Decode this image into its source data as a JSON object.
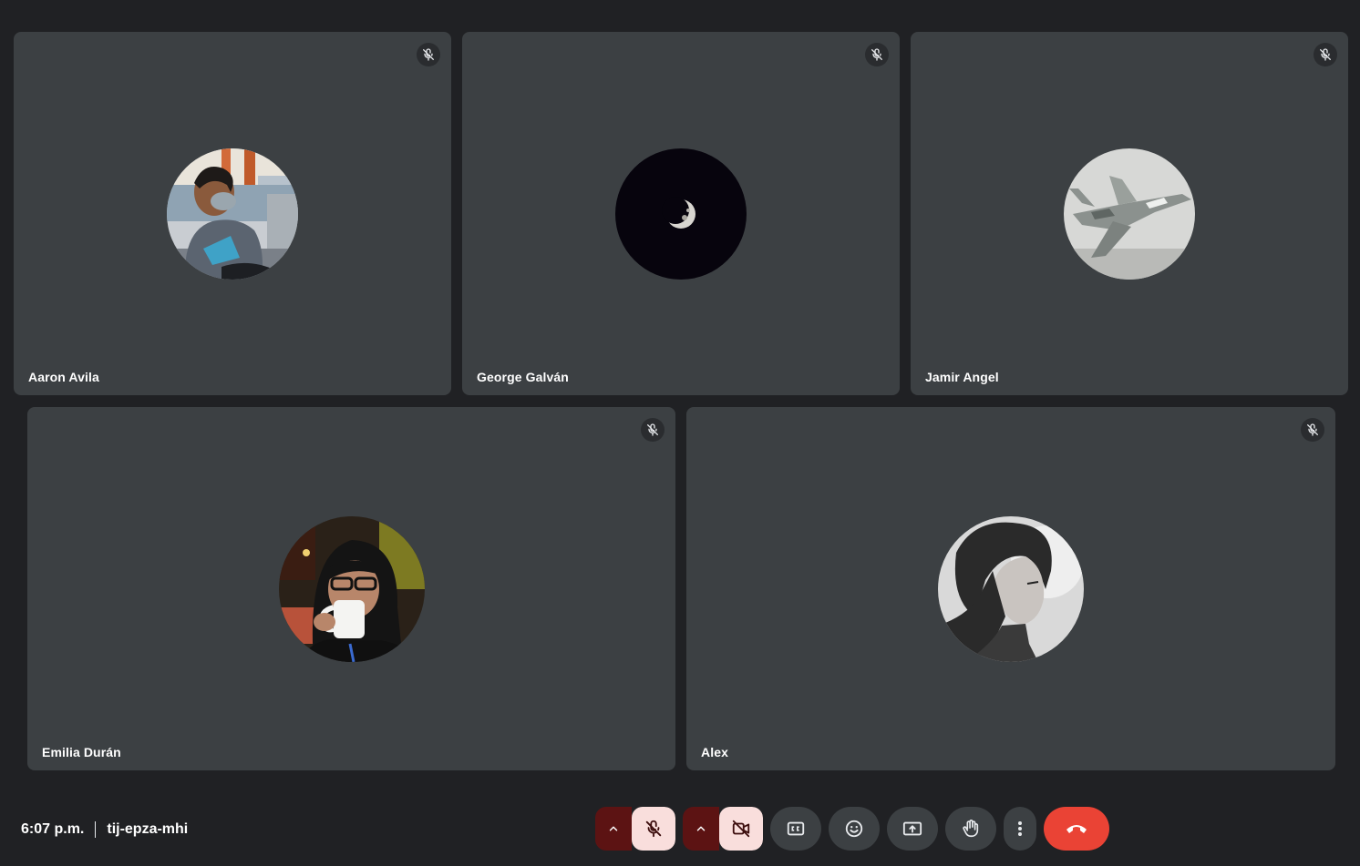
{
  "meeting": {
    "time": "6:07 p.m.",
    "code": "tij-epza-mhi"
  },
  "participants": [
    {
      "name": "Aaron Avila",
      "muted": true,
      "avatar": "photo-person-mask"
    },
    {
      "name": "George Galván",
      "muted": true,
      "avatar": "photo-moon"
    },
    {
      "name": "Jamir Angel",
      "muted": true,
      "avatar": "photo-jet"
    },
    {
      "name": "Emilia Durán",
      "muted": true,
      "avatar": "photo-person-mug"
    },
    {
      "name": "Alex",
      "muted": true,
      "avatar": "illustration-character"
    }
  ],
  "controls": [
    {
      "name": "audio-options",
      "icon": "chevron-up-icon"
    },
    {
      "name": "microphone",
      "icon": "mic-off-icon",
      "state": "off"
    },
    {
      "name": "video-options",
      "icon": "chevron-up-icon"
    },
    {
      "name": "camera",
      "icon": "videocam-off-icon",
      "state": "off"
    },
    {
      "name": "captions",
      "icon": "closed-captions-icon"
    },
    {
      "name": "reactions",
      "icon": "emoji-icon"
    },
    {
      "name": "present",
      "icon": "present-screen-icon"
    },
    {
      "name": "raise-hand",
      "icon": "hand-icon"
    },
    {
      "name": "more-options",
      "icon": "more-vert-icon"
    },
    {
      "name": "leave-call",
      "icon": "call-end-icon"
    }
  ],
  "colors": {
    "background": "#202124",
    "tile": "#3c4043",
    "end_call": "#ea4335",
    "toggle_off_bg": "#f9dedc",
    "toggle_off_caret": "#5c1313"
  }
}
